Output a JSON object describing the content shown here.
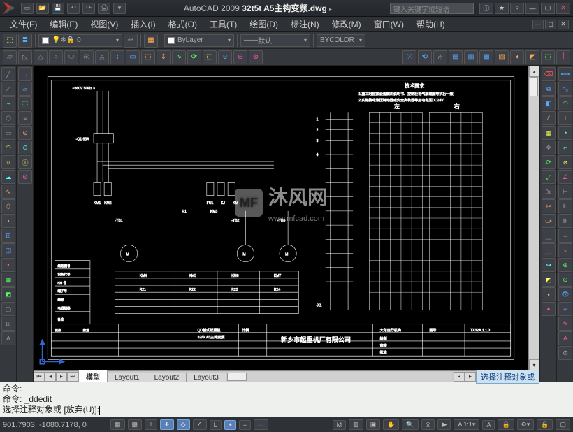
{
  "titlebar": {
    "app": "AutoCAD 2009",
    "doc": "32t5t A5主钩变频.dwg",
    "search_placeholder": "键入关键字或短语"
  },
  "menus": [
    "文件(F)",
    "编辑(E)",
    "视图(V)",
    "插入(I)",
    "格式(O)",
    "工具(T)",
    "绘图(D)",
    "标注(N)",
    "修改(M)",
    "窗口(W)",
    "帮助(H)"
  ],
  "layer_props": {
    "current": "0",
    "bylayer": "ByLayer",
    "default_linetype": "默认",
    "bycolor": "BYCOLOR"
  },
  "tabs": {
    "active": "模型",
    "others": [
      "Layout1",
      "Layout2",
      "Layout3"
    ]
  },
  "annoscale": "选择注释对象或",
  "cmd": {
    "l1": "命令:",
    "l2": "命令:  _ddedit",
    "l3": "选择注释对象或 [放弃(U)]:"
  },
  "status": {
    "coords": "901.7903, -1080.7178, 0"
  },
  "watermark": {
    "main": "沐风网",
    "sub": "www.mfcad.com",
    "logo": "MF"
  },
  "drawing": {
    "tech_title": "技术要求",
    "tech_1": "1.施工时应按设备随机说明书、控制柜电气原理图等执行一致",
    "tech_2": "2.实际接电液压制动器或安全夹轨器等用电电压DC24V",
    "left_lbl": "左",
    "right_lbl": "右",
    "company": "新乡市起重机厂有限公司",
    "titleblock_proj": "QD桥式起重机",
    "titleblock_model": "32/5t A5主钩变频",
    "titleblock_part": "大车运行机构",
    "titleblock_dwgno": "TX32A.1.1.0",
    "titleblock_scale": "比例",
    "titleblock_draw": "绘制",
    "titleblock_check": "审核",
    "titleblock_appr": "批准",
    "top_wire": "~380V 50Hz 3"
  }
}
